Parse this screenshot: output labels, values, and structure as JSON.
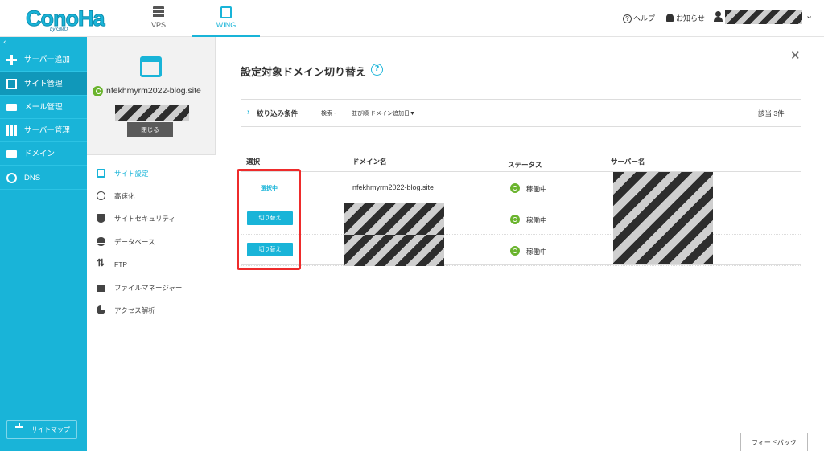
{
  "header": {
    "logo_text": "ConoHa",
    "logo_sub": "by GMO",
    "tabs": [
      {
        "label": "VPS"
      },
      {
        "label": "WING"
      }
    ],
    "help_label": "ヘルプ",
    "news_label": "お知らせ"
  },
  "sidebar": {
    "items": [
      {
        "label": "サーバー追加",
        "icon": "plus-icon"
      },
      {
        "label": "サイト管理",
        "icon": "window-icon"
      },
      {
        "label": "メール管理",
        "icon": "mail-icon"
      },
      {
        "label": "サーバー管理",
        "icon": "server-icon"
      },
      {
        "label": "ドメイン",
        "icon": "domain-icon"
      },
      {
        "label": "DNS",
        "icon": "globe-icon"
      }
    ],
    "sitemap_label": "サイトマップ"
  },
  "site_panel": {
    "domain": "nfekhmyrm2022-blog.site",
    "close_label": "閉じる",
    "menu": [
      {
        "label": "サイト設定"
      },
      {
        "label": "高速化"
      },
      {
        "label": "サイトセキュリティ"
      },
      {
        "label": "データベース"
      },
      {
        "label": "FTP"
      },
      {
        "label": "ファイルマネージャー"
      },
      {
        "label": "アクセス解析"
      }
    ]
  },
  "main": {
    "title": "設定対象ドメイン切り替え",
    "filter": {
      "label": "絞り込み条件",
      "search": "検索 -",
      "sort": "並び順  ドメイン追加日▼",
      "count": "該当 3件"
    },
    "columns": {
      "select": "選択",
      "domain": "ドメイン名",
      "status": "ステータス",
      "server": "サーバー名"
    },
    "rows": [
      {
        "select": "選択中",
        "domain": "nfekhmyrm2022-blog.site",
        "status": "稼働中"
      },
      {
        "select": "切り替え",
        "domain": "",
        "status": "稼働中"
      },
      {
        "select": "切り替え",
        "domain": "",
        "status": "稼働中"
      }
    ],
    "feedback_label": "フィードバック"
  },
  "colors": {
    "accent": "#19b4d8",
    "status_ok": "#6ab42d",
    "highlight": "#ee2b2b"
  }
}
